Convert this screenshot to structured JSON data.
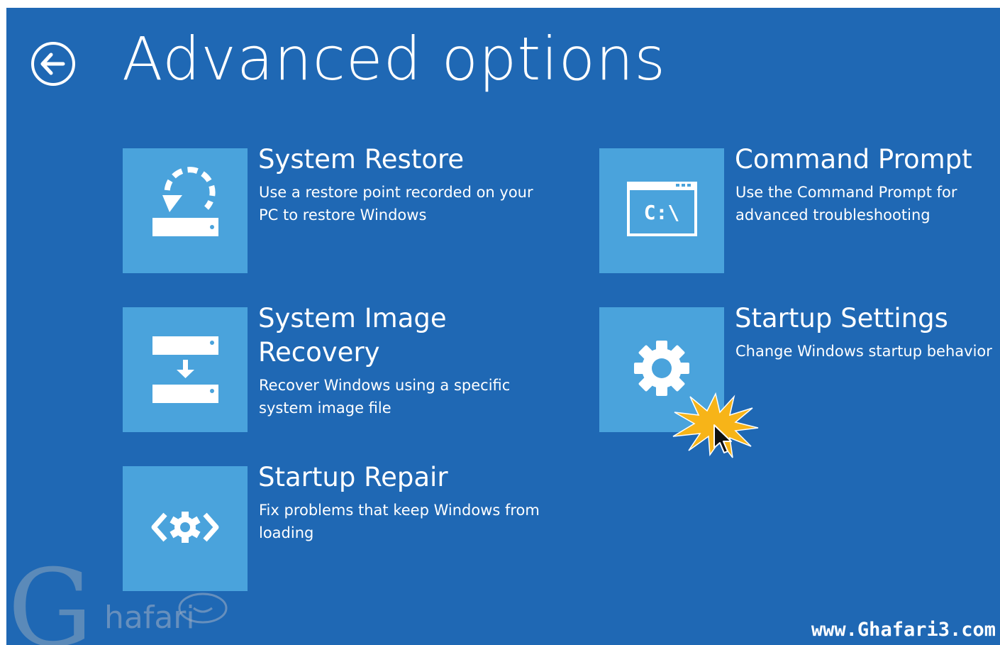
{
  "header": {
    "title": "Advanced options",
    "back_icon": "back-arrow-circle-icon"
  },
  "options": [
    {
      "id": "system-restore",
      "title": "System Restore",
      "lines": [
        "Use a restore point recorded on your",
        "PC to restore Windows"
      ],
      "icon": "restore-drive-icon"
    },
    {
      "id": "command-prompt",
      "title": "Command Prompt",
      "lines": [
        "Use the Command Prompt for",
        "advanced troubleshooting"
      ],
      "icon": "command-prompt-icon",
      "icon_text": "C:\\"
    },
    {
      "id": "system-image-recovery",
      "title_lines": [
        "System Image",
        "Recovery"
      ],
      "lines": [
        "Recover Windows using a specific",
        "system image file"
      ],
      "icon": "image-recovery-icon"
    },
    {
      "id": "startup-settings",
      "title": "Startup Settings",
      "lines": [
        "Change Windows startup behavior"
      ],
      "icon": "gear-icon"
    },
    {
      "id": "startup-repair",
      "title": "Startup Repair",
      "lines": [
        "Fix problems that keep Windows from",
        "loading"
      ],
      "icon": "startup-repair-icon"
    }
  ],
  "watermark": {
    "letter": "G",
    "word": "hafari",
    "url": "www.Ghafari3.com"
  },
  "colors": {
    "background": "#1f68b4",
    "tile": "#4aa3dc",
    "text": "#ffffff",
    "click_burst": "#f7b418"
  }
}
